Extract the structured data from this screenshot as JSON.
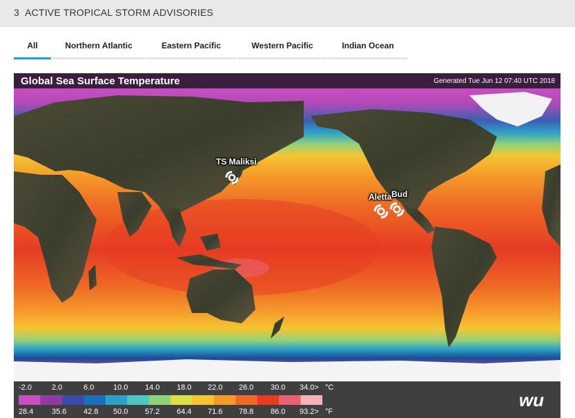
{
  "header": {
    "count": "3",
    "title": "ACTIVE TROPICAL STORM ADVISORIES"
  },
  "tabs": [
    {
      "label": "All",
      "active": true
    },
    {
      "label": "Northern Atlantic",
      "active": false
    },
    {
      "label": "Eastern Pacific",
      "active": false
    },
    {
      "label": "Western Pacific",
      "active": false
    },
    {
      "label": "Indian Ocean",
      "active": false
    }
  ],
  "map": {
    "title": "Global Sea Surface Temperature",
    "generated": "Generated Tue Jun 12 07:40 UTC 2018",
    "storms": [
      {
        "name": "TS Maliksi"
      },
      {
        "name": "Aletta"
      },
      {
        "name": "Bud"
      }
    ],
    "logo": "wu",
    "legend": {
      "celsius": [
        "-2.0",
        "2.0",
        "6.0",
        "10.0",
        "14.0",
        "18.0",
        "22.0",
        "26.0",
        "30.0",
        "34.0>"
      ],
      "fahrenheit": [
        "28.4",
        "35.6",
        "42.8",
        "50.0",
        "57.2",
        "64.4",
        "71.6",
        "78.8",
        "86.0",
        "93.2>"
      ],
      "unit_c": "°C",
      "unit_f": "°F",
      "colors": [
        "#c74fc0",
        "#8e3d9e",
        "#3c4aa8",
        "#1b6fb8",
        "#2ea0c8",
        "#4fc7c0",
        "#8fd27a",
        "#d9e04a",
        "#f5c531",
        "#f59a2a",
        "#ef6a25",
        "#e63b23",
        "#e8626e",
        "#f4b2b9"
      ]
    }
  }
}
